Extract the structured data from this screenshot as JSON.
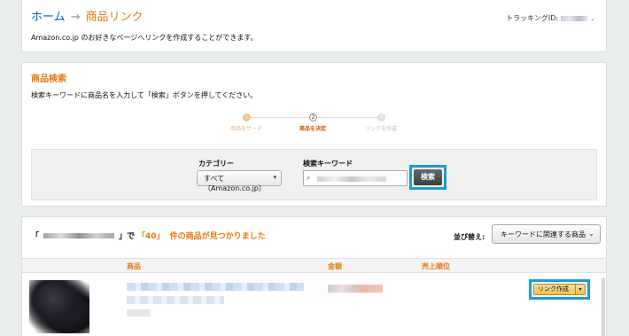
{
  "breadcrumb": {
    "home": "ホーム",
    "separator": "→",
    "current": "商品リンク"
  },
  "intro": "Amazon.co.jp のお好きなページへリンクを作成することができます。",
  "tracking": {
    "label": "トラッキングID:",
    "chevron": "⌄"
  },
  "search_panel": {
    "title": "商品検索",
    "instruction": "検索キーワードに商品名を入力して「検索」ボタンを押してください。",
    "steps": [
      {
        "num": "1",
        "label": "商品をサーチ"
      },
      {
        "num": "2",
        "label": "商品を決定"
      },
      {
        "num": "3",
        "label": "リンクを作成"
      }
    ],
    "category_label": "カテゴリー",
    "category_value": "すべて（Amazon.co.jp）",
    "keyword_label": "検索キーワード",
    "search_button": "検索"
  },
  "results": {
    "prefix": "「",
    "suffix_mid": "」で",
    "count_text": "「40」",
    "suffix": "件の商品が見つかりました",
    "sort_label": "並び替え:",
    "sort_value": "キーワードに関連する商品",
    "columns": [
      "商品",
      "金額",
      "売上順位"
    ],
    "link_button": "リンク作成"
  },
  "colors": {
    "accent": "#e47911",
    "link": "#0066c0",
    "highlight": "#1d9bd6",
    "button_yellow": "#f0c14b"
  }
}
